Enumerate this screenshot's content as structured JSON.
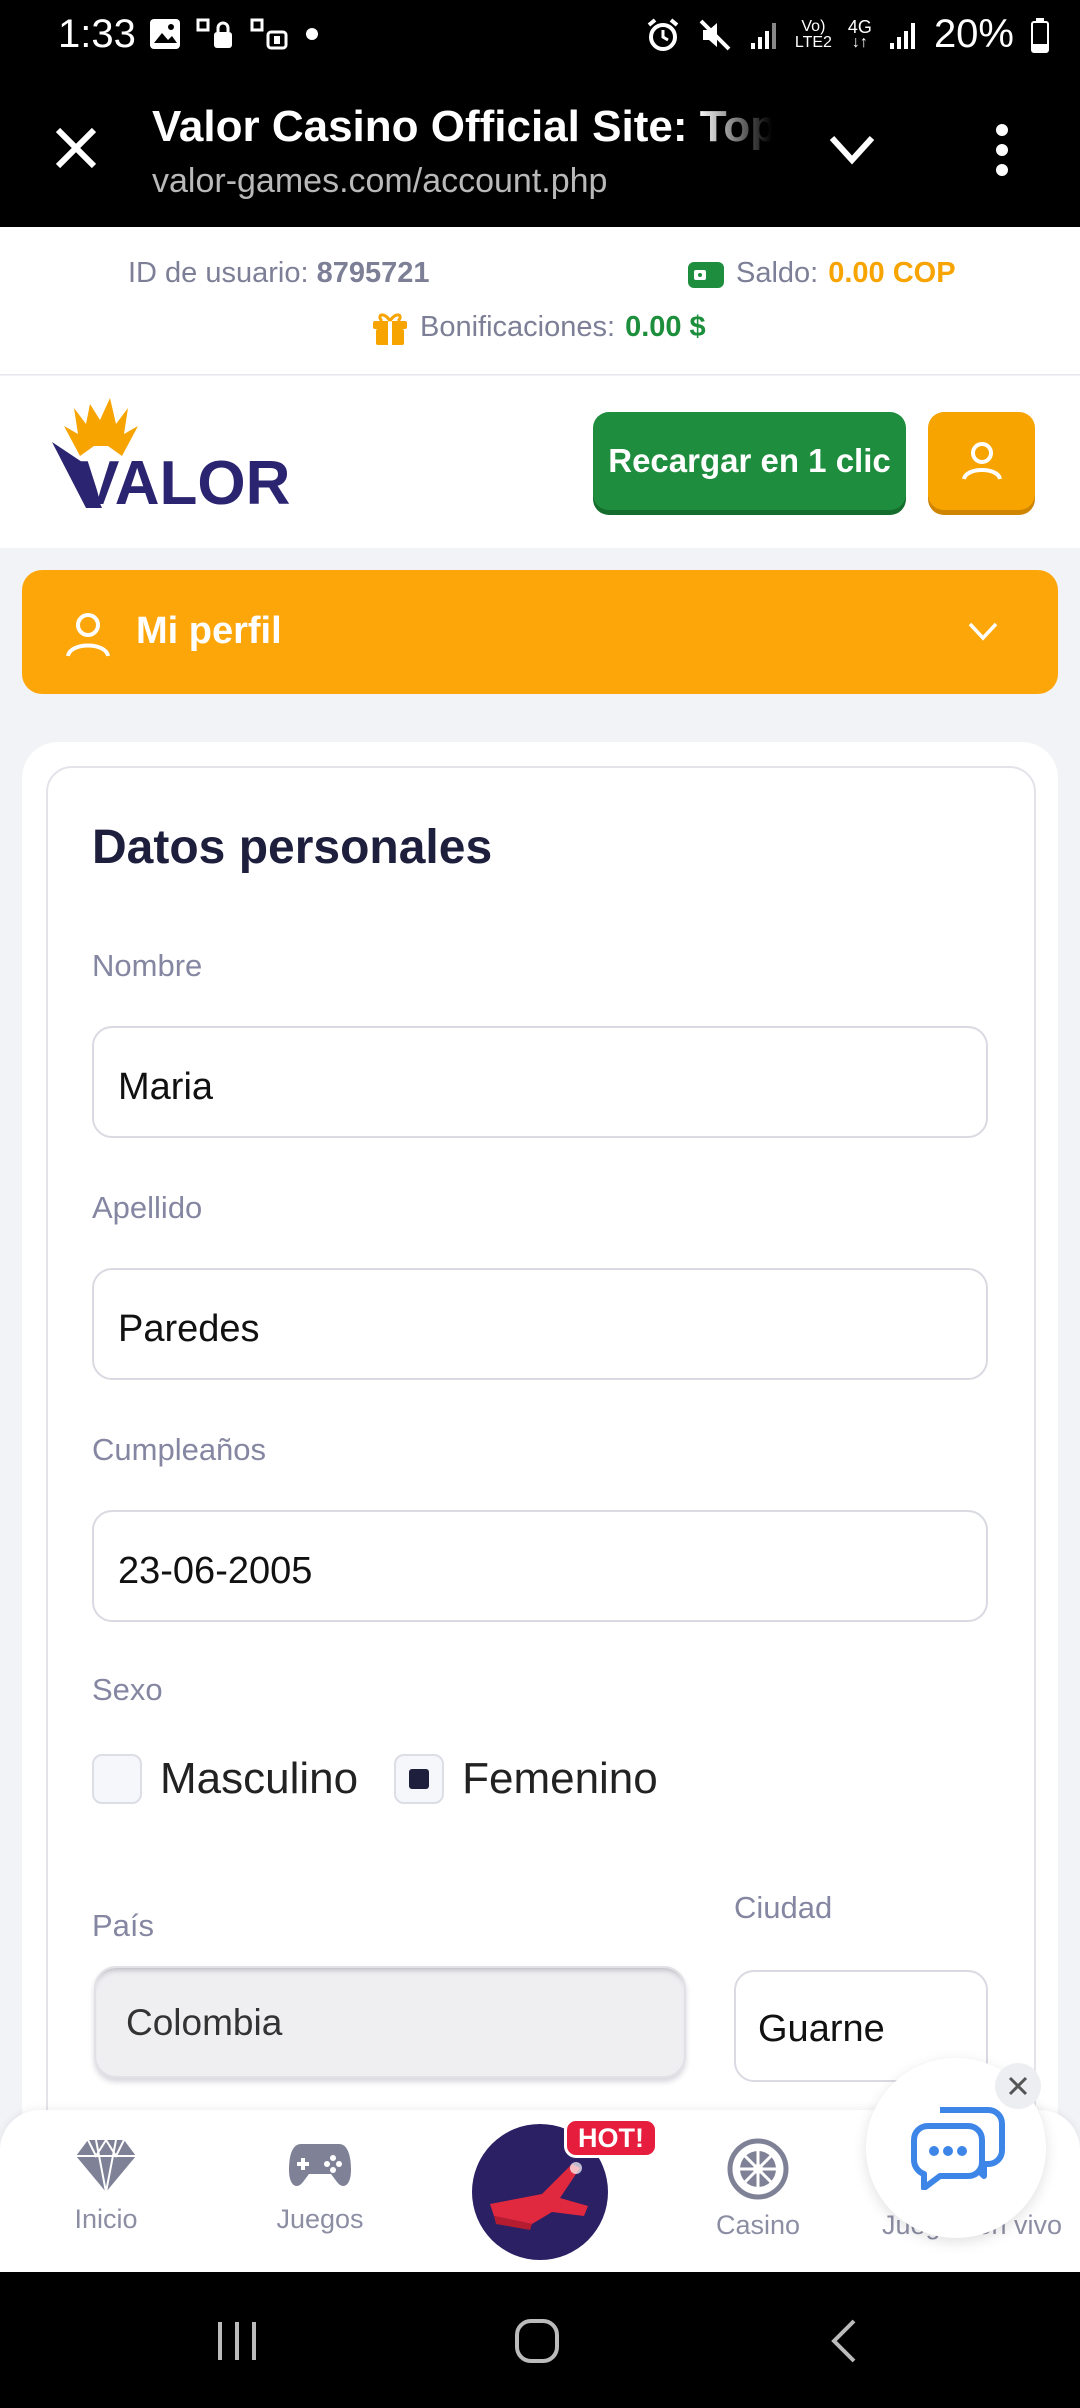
{
  "status_bar": {
    "time": "1:33",
    "battery": "20%",
    "network_small_top": "Vo)",
    "network_small_bottom": "LTE2",
    "network_type": "4G"
  },
  "browser": {
    "title": "Valor Casino Official Site: Top Casino",
    "url": "valor-games.com/account.php"
  },
  "account_info": {
    "user_id_label": "ID de usuario:",
    "user_id_value": "8795721",
    "balance_label": "Saldo:",
    "balance_value": "0.00 COP",
    "bonus_label": "Bonificaciones:",
    "bonus_value": "0.00 $"
  },
  "header": {
    "logo_text": "VALOR",
    "recharge_button": "Recargar en 1 clic"
  },
  "profile_menu": {
    "label": "Mi perfil"
  },
  "form": {
    "title": "Datos personales",
    "first_name_label": "Nombre",
    "first_name_value": "Maria",
    "last_name_label": "Apellido",
    "last_name_value": "Paredes",
    "birthday_label": "Cumpleaños",
    "birthday_value": "23-06-2005",
    "sex_label": "Sexo",
    "sex_options": [
      "Masculino",
      "Femenino"
    ],
    "sex_selected": "Femenino",
    "country_label": "País",
    "country_value": "Colombia",
    "city_label": "Ciudad",
    "city_value": "Guarne"
  },
  "bottom_nav": {
    "items": [
      "Inicio",
      "Juegos",
      "Casino",
      "Juegos en vivo"
    ],
    "hot_badge": "HOT!"
  },
  "colors": {
    "accent_orange": "#fca60a",
    "button_green": "#1e8e3e",
    "dark_text": "#1d1f3c"
  }
}
